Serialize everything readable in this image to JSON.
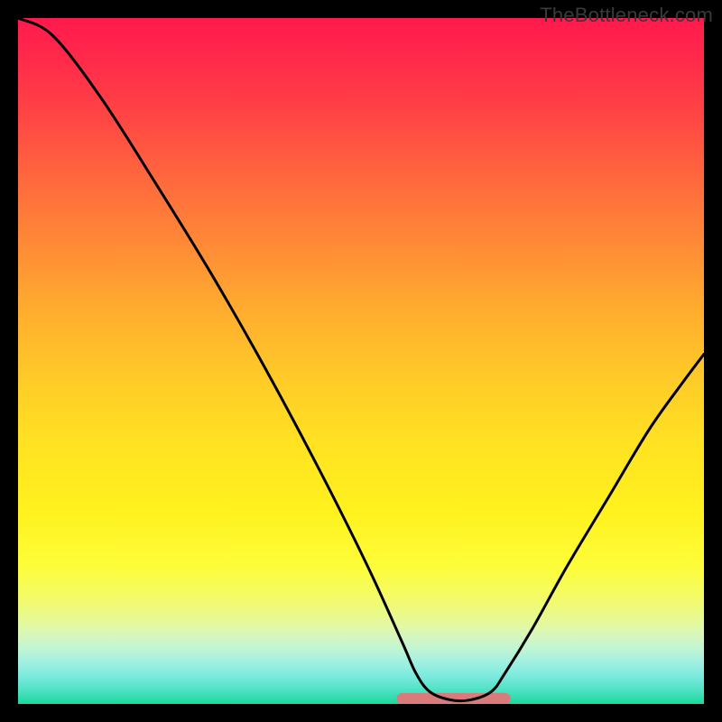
{
  "watermark": {
    "text": "TheBottleneck.com"
  },
  "colors": {
    "frame": "#000000",
    "curve_stroke": "#000000",
    "marker_fill": "#d97b7a",
    "gradient_top": "#ff1a4d",
    "gradient_bottom": "#1ad99a"
  },
  "chart_data": {
    "type": "line",
    "title": "",
    "xlabel": "",
    "ylabel": "",
    "xlim": [
      0,
      100
    ],
    "ylim": [
      0,
      100
    ],
    "grid": false,
    "legend": false,
    "note": "Background is a vertical hue gradient (red→green). The black curve is a V-shaped bottleneck trace with its minimum near x≈63 at y≈0. A short salmon horizontal marker spans roughly x≈56–71 at the floor.",
    "curve_points": [
      {
        "x": 0,
        "y": 100
      },
      {
        "x": 5,
        "y": 97.5
      },
      {
        "x": 12,
        "y": 88.5
      },
      {
        "x": 20,
        "y": 76
      },
      {
        "x": 28,
        "y": 63
      },
      {
        "x": 36,
        "y": 49
      },
      {
        "x": 44,
        "y": 34
      },
      {
        "x": 51,
        "y": 20
      },
      {
        "x": 56,
        "y": 9
      },
      {
        "x": 58,
        "y": 4.5
      },
      {
        "x": 60,
        "y": 1.8
      },
      {
        "x": 63,
        "y": 0.6
      },
      {
        "x": 66,
        "y": 0.6
      },
      {
        "x": 69,
        "y": 1.8
      },
      {
        "x": 71,
        "y": 4.5
      },
      {
        "x": 75,
        "y": 11
      },
      {
        "x": 80,
        "y": 20
      },
      {
        "x": 86,
        "y": 30
      },
      {
        "x": 92,
        "y": 40
      },
      {
        "x": 97,
        "y": 47
      },
      {
        "x": 100,
        "y": 51
      }
    ],
    "floor_marker": {
      "x_start": 56,
      "x_end": 71,
      "y": 0.8
    }
  }
}
